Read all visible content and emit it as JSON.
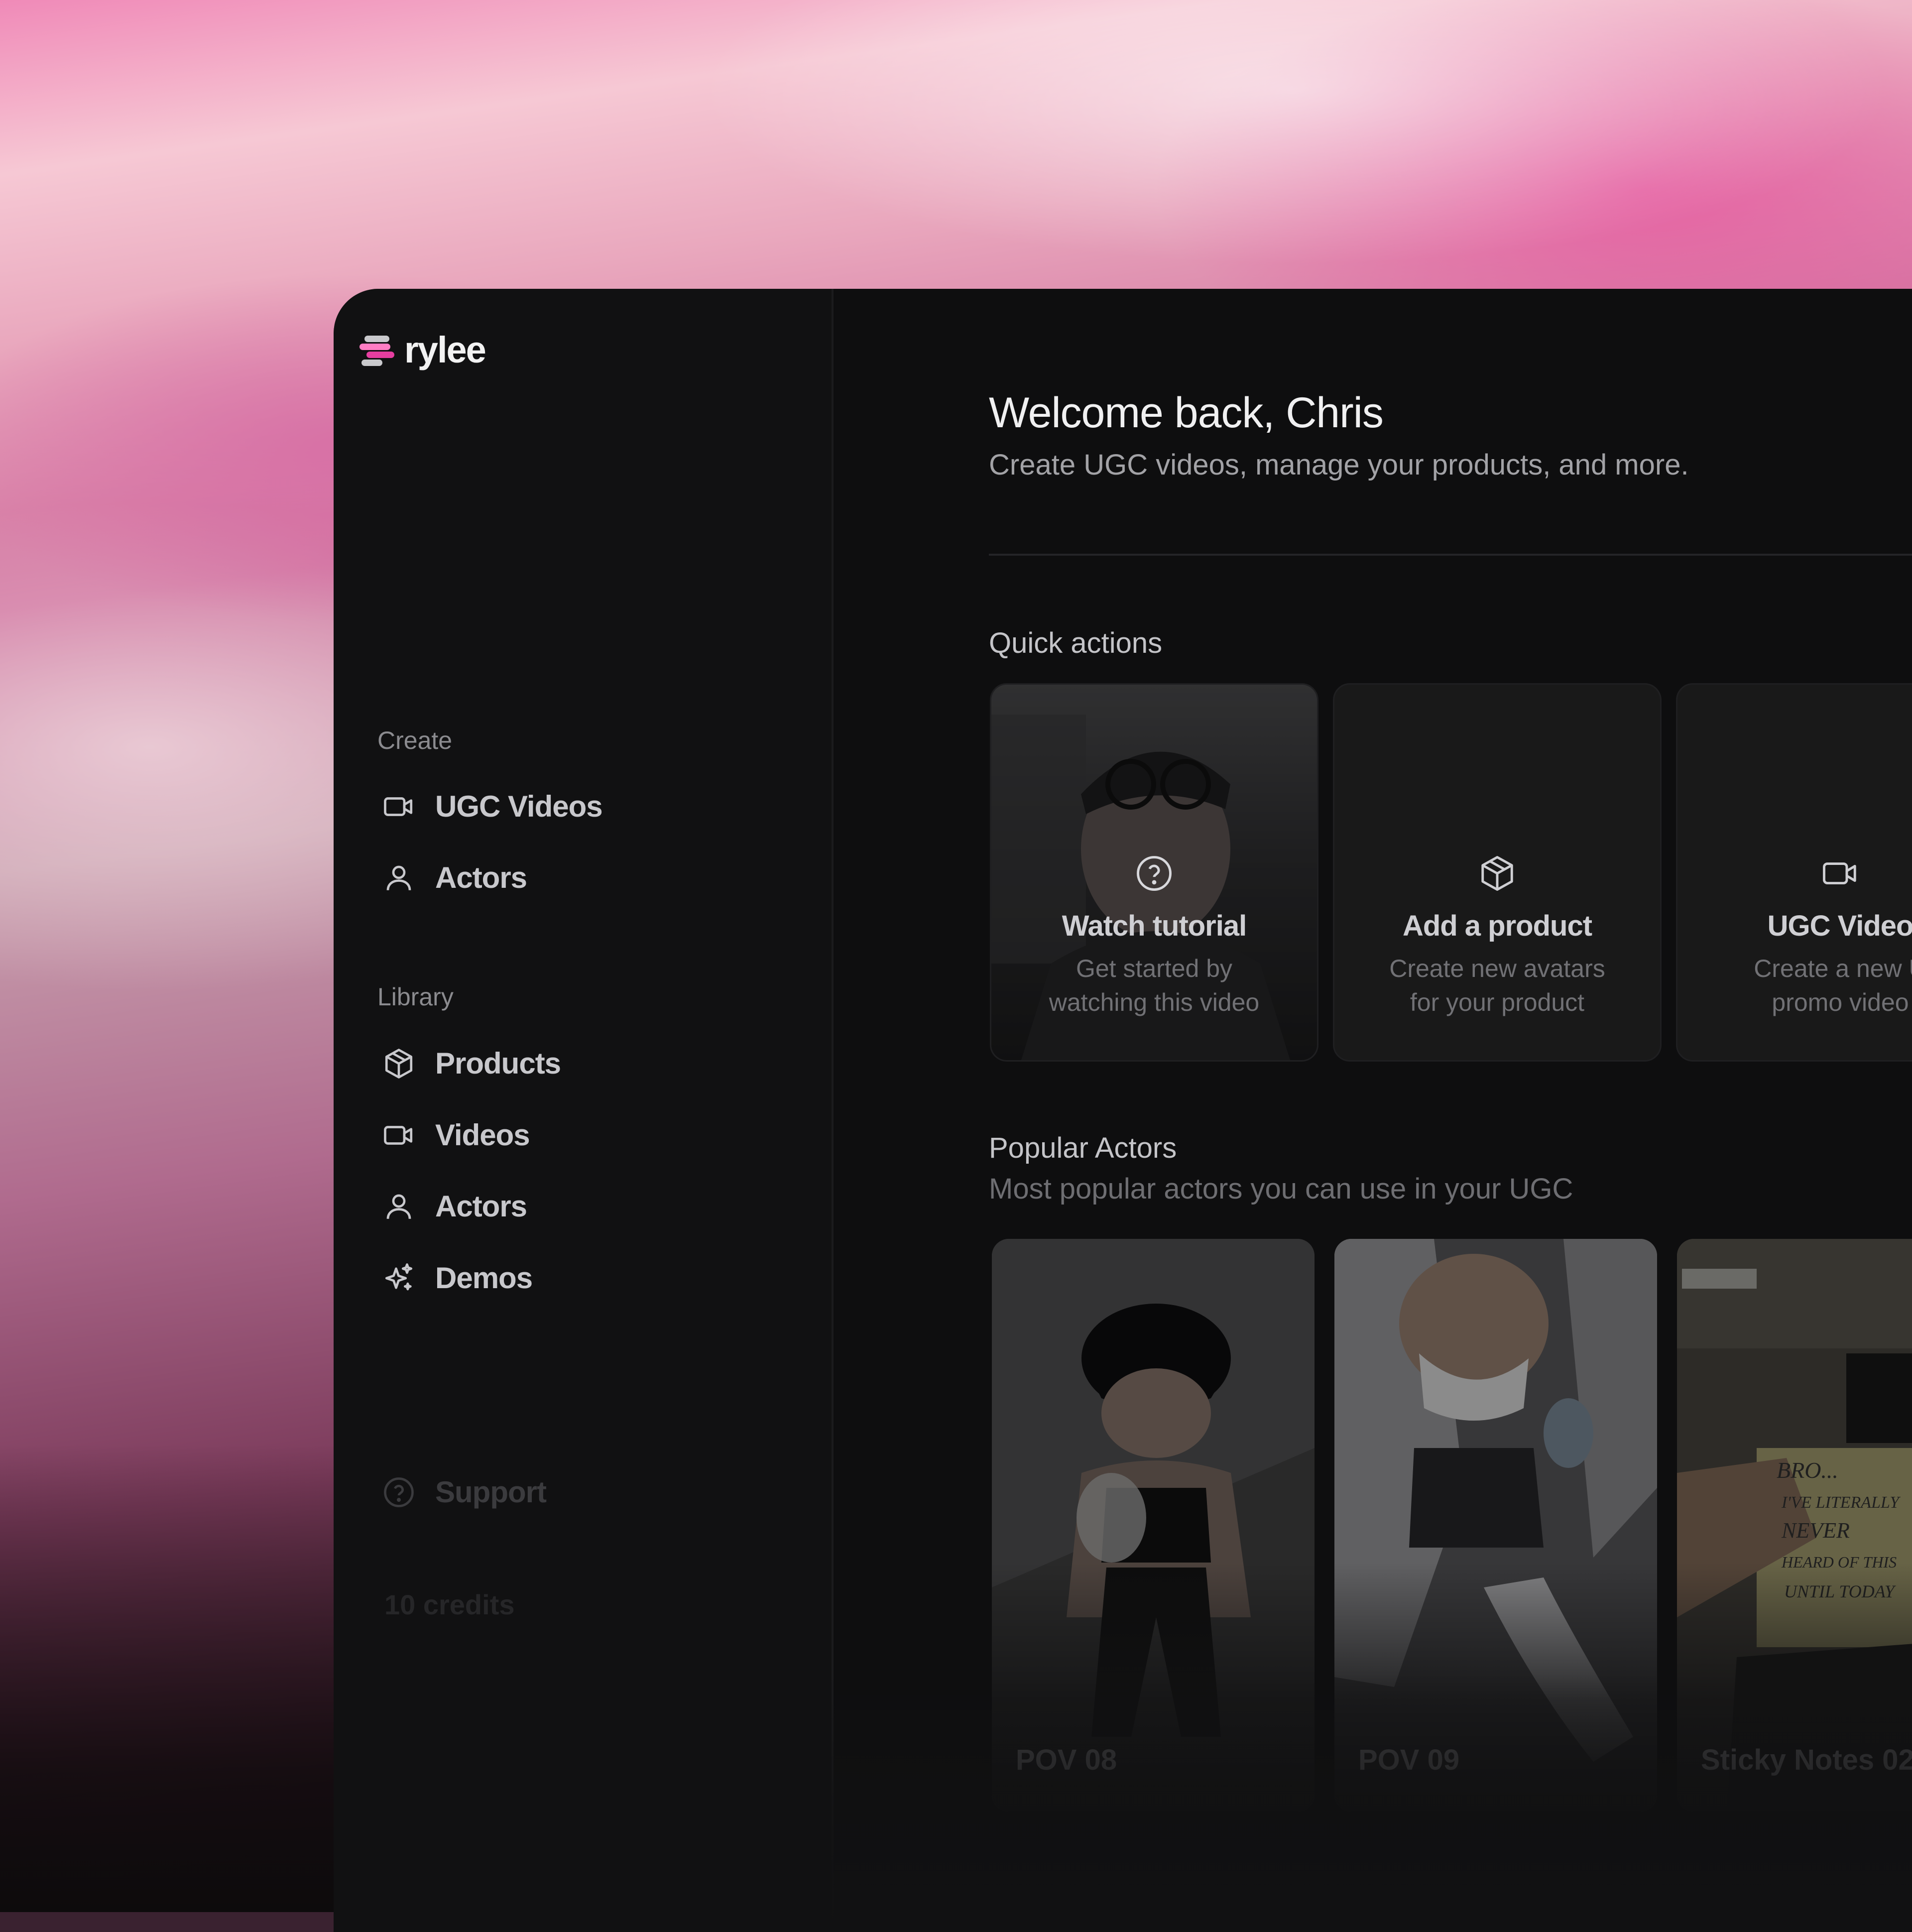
{
  "app": {
    "logo_text": "rylee",
    "brand_colors": [
      "#e63ea0",
      "#ff7dc3",
      "#c9c9cc"
    ]
  },
  "sidebar": {
    "create_label": "Create",
    "create_items": [
      {
        "label": "UGC Videos",
        "icon": "video-icon"
      },
      {
        "label": "Actors",
        "icon": "user-icon"
      }
    ],
    "library_label": "Library",
    "library_items": [
      {
        "label": "Products",
        "icon": "box-icon"
      },
      {
        "label": "Videos",
        "icon": "video-icon"
      },
      {
        "label": "Actors",
        "icon": "user-icon"
      },
      {
        "label": "Demos",
        "icon": "sparkles-icon"
      }
    ],
    "support_label": "Support",
    "credits": "10 credits"
  },
  "main": {
    "title": "Welcome back, Chris",
    "subtitle": "Create UGC videos, manage your products, and more.",
    "quick_actions": {
      "heading": "Quick actions",
      "cards": [
        {
          "title": "Watch tutorial",
          "description": "Get started by\nwatching this video",
          "icon": "question-circle-icon"
        },
        {
          "title": "Add a product",
          "description": "Create new avatars\nfor your product",
          "icon": "box-icon"
        },
        {
          "title": "UGC Video",
          "description": "Create a new U\npromo video",
          "icon": "video-icon"
        }
      ]
    },
    "popular_actors": {
      "heading": "Popular Actors",
      "subheading": "Most popular actors you can use in your UGC",
      "actors": [
        {
          "name": "POV 08"
        },
        {
          "name": "POV 09"
        },
        {
          "name": "Sticky Notes 02"
        }
      ],
      "sticky_note_text": [
        "BRO...",
        "I'VE LITERALLY",
        "NEVER",
        "HEARD OF THIS",
        "UNTIL TODAY"
      ]
    }
  }
}
